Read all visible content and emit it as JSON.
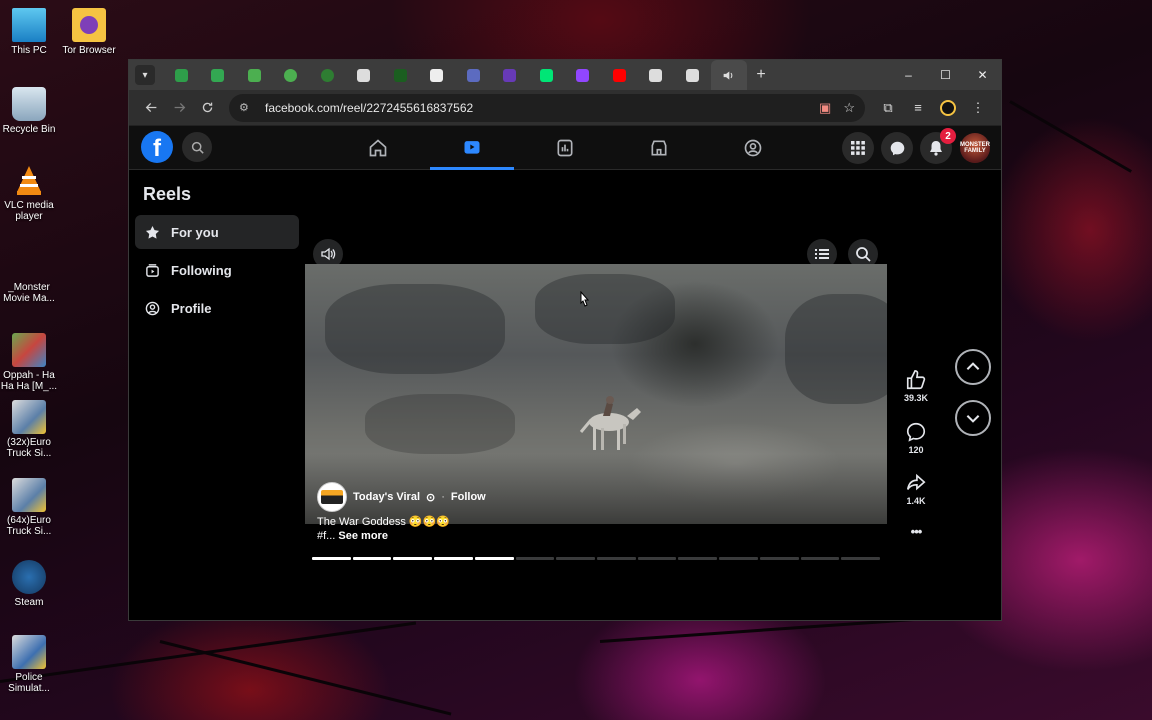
{
  "desktop": {
    "icons": [
      {
        "label": "This PC",
        "icon": "monitor-icon"
      },
      {
        "label": "Tor Browser",
        "icon": "folder-icon"
      },
      {
        "label": "Recycle Bin",
        "icon": "recycle-bin-icon"
      },
      {
        "label": "VLC media player",
        "icon": "vlc-icon"
      },
      {
        "label": "_Monster Movie Ma...",
        "icon": "file-icon"
      },
      {
        "label": "Oppah - Ha Ha Ha [M_...",
        "icon": "video-file-icon"
      },
      {
        "label": "(32x)Euro Truck Si...",
        "icon": "game-icon"
      },
      {
        "label": "(64x)Euro Truck Si...",
        "icon": "game-icon"
      },
      {
        "label": "Steam",
        "icon": "steam-icon"
      },
      {
        "label": "Police Simulat...",
        "icon": "game-icon"
      }
    ]
  },
  "browser": {
    "url": "facebook.com/reel/2272455616837562",
    "tab_favicon_colors": [
      "#2e9e4a",
      "#33a852",
      "#4caf50",
      "#4caf50",
      "#2e7d32",
      "#dddddd",
      "#1b5e20",
      "#eeeeee",
      "#5c6bc0",
      "#673ab7",
      "#00e676",
      "#9146ff",
      "#ff0000",
      "#dddddd",
      "#dddddd"
    ],
    "active_tab_icon": "speaker-icon",
    "new_tab_symbol": "+",
    "window_controls": {
      "minimize": "–",
      "maximize": "☐",
      "close": "✕"
    }
  },
  "facebook": {
    "logo_letter": "f",
    "notification_count": "2",
    "avatar_text": "MONSTER FAMILY",
    "brand_color": "#1877f2",
    "nav": [
      {
        "name": "home",
        "icon": "home-icon",
        "active": false
      },
      {
        "name": "video",
        "icon": "video-icon",
        "active": true
      },
      {
        "name": "pages",
        "icon": "pages-icon",
        "active": false
      },
      {
        "name": "marketplace",
        "icon": "marketplace-icon",
        "active": false
      },
      {
        "name": "groups",
        "icon": "groups-icon",
        "active": false
      }
    ]
  },
  "reels": {
    "title": "Reels",
    "menu": [
      {
        "label": "For you",
        "icon": "star-icon",
        "active": true
      },
      {
        "label": "Following",
        "icon": "following-icon",
        "active": false
      },
      {
        "label": "Profile",
        "icon": "profile-icon",
        "active": false
      }
    ],
    "author": "Today's Viral",
    "follow_separator": "·",
    "follow_label": "Follow",
    "caption": "The War Goddess 😳😳😳",
    "caption_prefix": "#f...",
    "see_more": "See more",
    "likes": "39.3K",
    "comments": "120",
    "shares": "1.4K",
    "more_symbol": "•••",
    "progress_segments_total": 14,
    "progress_segments_watched": 5
  }
}
